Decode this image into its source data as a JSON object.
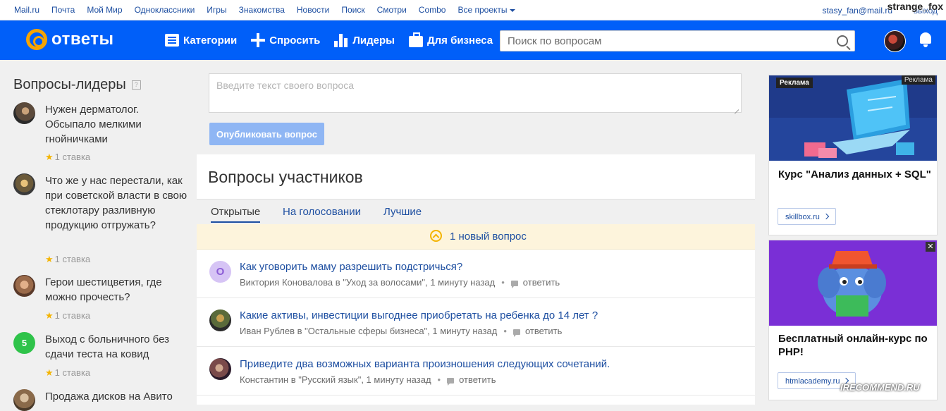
{
  "portal": {
    "links": [
      "Mail.ru",
      "Почта",
      "Мой Мир",
      "Одноклассники",
      "Игры",
      "Знакомства",
      "Новости",
      "Поиск",
      "Смотри",
      "Combo",
      "Все проекты"
    ],
    "user": "stasy_fan@mail.ru",
    "exit": "выход",
    "watermark": "strange_fox"
  },
  "header": {
    "logo_text": "ответы",
    "nav": [
      {
        "label": "Категории",
        "icon": "list-icon"
      },
      {
        "label": "Спросить",
        "icon": "plus-icon"
      },
      {
        "label": "Лидеры",
        "icon": "bars-icon"
      },
      {
        "label": "Для бизнеса",
        "icon": "briefcase-icon"
      }
    ],
    "search_placeholder": "Поиск по вопросам"
  },
  "left": {
    "title": "Вопросы-лидеры",
    "help": "?",
    "items": [
      {
        "text": "Нужен дерматолог. Обсыпало мелкими гнойничками",
        "stake": "1 ставка"
      },
      {
        "text": "Что же у нас перестали, как при советской власти в свою стеклотару разливную продукцию отгружать?",
        "stake": "1 ставка"
      },
      {
        "text": "Герои шестицветия, где можно прочесть?",
        "stake": "1 ставка"
      },
      {
        "text": "Выход с больничного без сдачи теста на ковид",
        "stake": "1 ставка",
        "avatar_letter": "5"
      },
      {
        "text": "Продажа дисков на Авито",
        "stake": ""
      }
    ]
  },
  "center": {
    "ask_placeholder": "Введите текст своего вопроса",
    "publish_label": "Опубликовать вопрос",
    "section_title": "Вопросы участников",
    "tabs": [
      "Открытые",
      "На голосовании",
      "Лучшие"
    ],
    "new_banner": "1 новый вопрос",
    "questions": [
      {
        "title": "Как уговорить маму разрешить подстричься?",
        "meta": "Виктория Коновалова в \"Уход за волосами\", 1 минуту назад",
        "answer": "ответить",
        "avatar_letter": "О"
      },
      {
        "title": "Какие активы, инвестиции выгоднее приобретать на ребенка до 14 лет ?",
        "meta": "Иван Рублев в \"Остальные сферы бизнеса\", 1 минуту назад",
        "answer": "ответить"
      },
      {
        "title": "Приведите два возможных варианта произношения следующих сочетаний.",
        "meta": "Константин в \"Русский язык\", 1 минуту назад",
        "answer": "ответить"
      }
    ]
  },
  "ads": [
    {
      "label": "Реклама",
      "label_right": "Реклама",
      "title": "Курс \"Анализ данных + SQL\"",
      "button": "skillbox.ru"
    },
    {
      "close": "✕",
      "title": "Бесплатный онлайн-курс по PHP!",
      "button": "htmlacademy.ru"
    }
  ],
  "watermark_bottom": "IRECOMMEND.RU",
  "colors": {
    "brand_blue": "#005ff9",
    "link": "#1e4fa1",
    "accent_orange": "#f7a400",
    "star": "#f4b400"
  }
}
